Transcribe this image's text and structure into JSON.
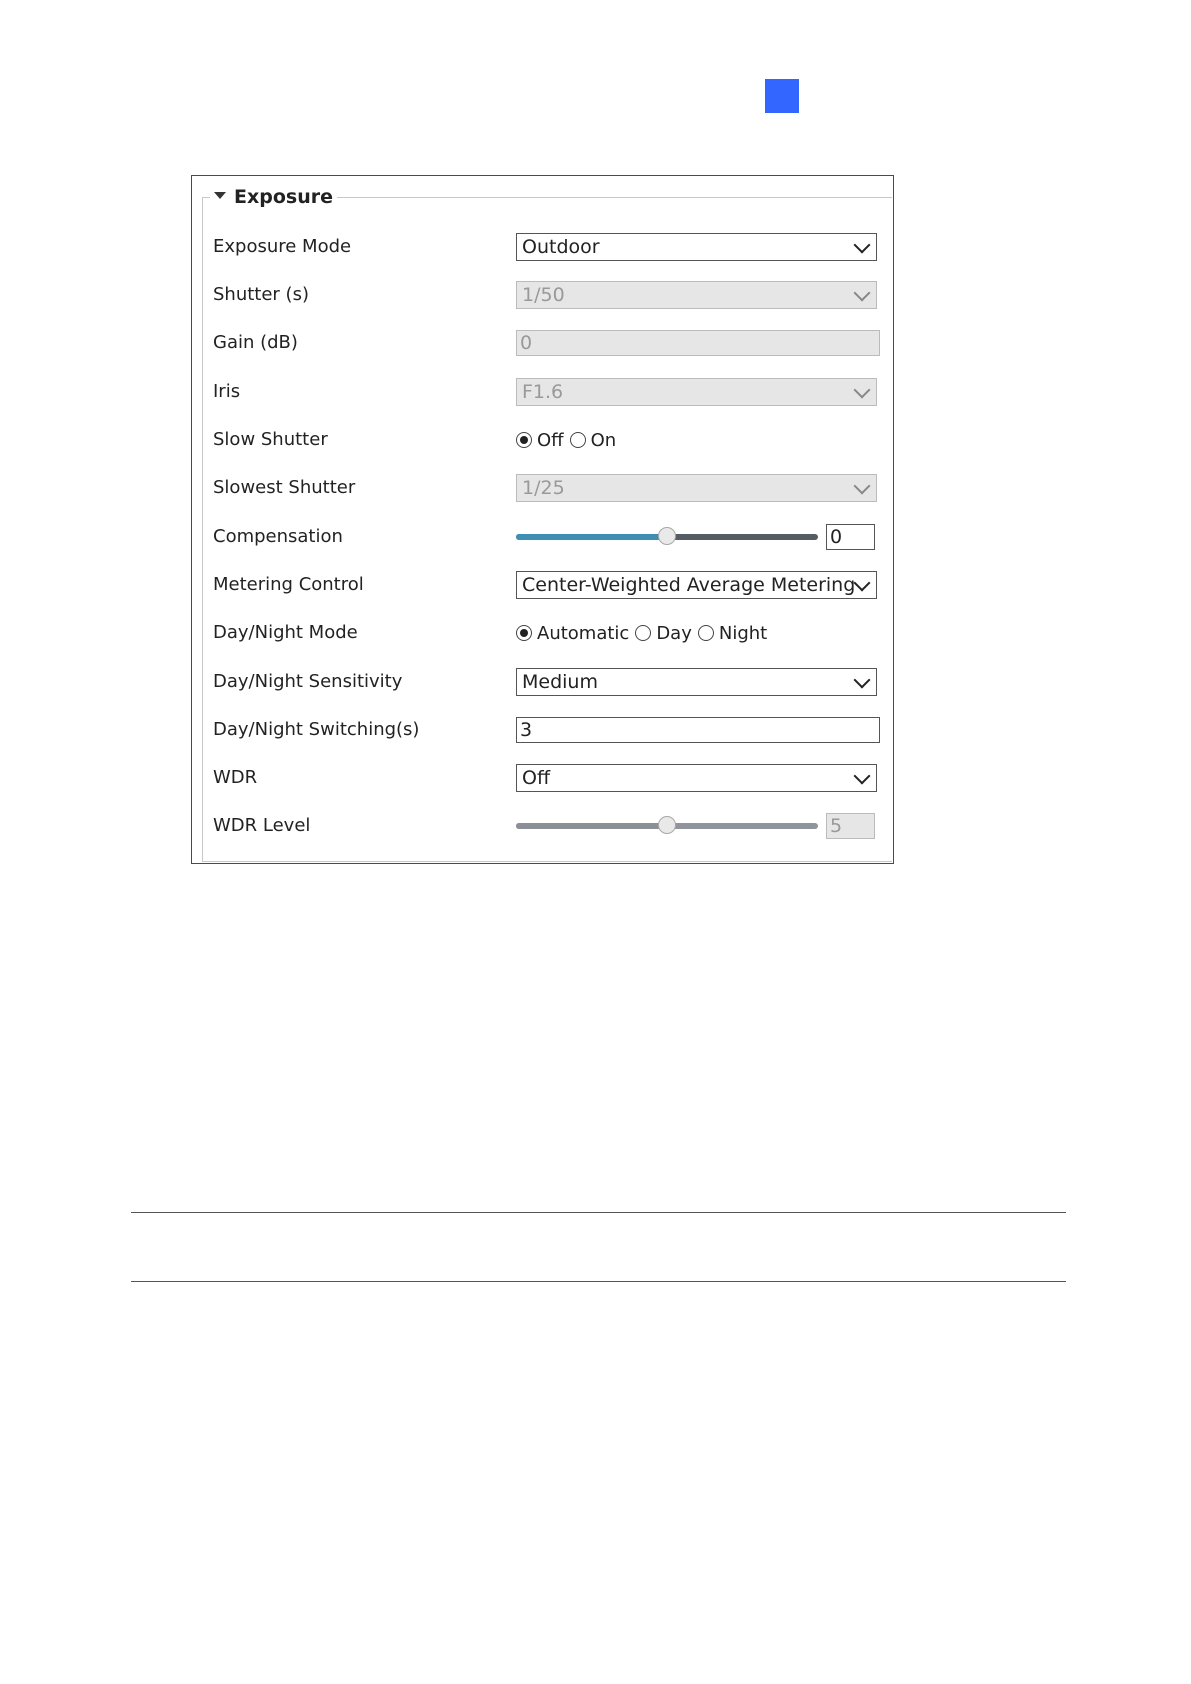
{
  "panel": {
    "legend": "Exposure",
    "fields": {
      "exposure_mode": {
        "label": "Exposure Mode",
        "value": "Outdoor"
      },
      "shutter": {
        "label": "Shutter (s)",
        "value": "1/50"
      },
      "gain": {
        "label": "Gain (dB)",
        "value": "0"
      },
      "iris": {
        "label": "Iris",
        "value": "F1.6"
      },
      "slow_shutter": {
        "label": "Slow Shutter",
        "options": [
          "Off",
          "On"
        ],
        "selected": "Off"
      },
      "slowest_shutter": {
        "label": "Slowest Shutter",
        "value": "1/25"
      },
      "compensation": {
        "label": "Compensation",
        "value": "0",
        "slider_fraction": 0.5
      },
      "metering_control": {
        "label": "Metering Control",
        "value": "Center-Weighted Average Metering"
      },
      "day_night_mode": {
        "label": "Day/Night Mode",
        "options": [
          "Automatic",
          "Day",
          "Night"
        ],
        "selected": "Automatic"
      },
      "day_night_sensitivity": {
        "label": "Day/Night Sensitivity",
        "value": "Medium"
      },
      "day_night_switching": {
        "label": "Day/Night Switching(s)",
        "value": "3"
      },
      "wdr": {
        "label": "WDR",
        "value": "Off"
      },
      "wdr_level": {
        "label": "WDR Level",
        "value": "5",
        "slider_fraction": 0.5
      }
    }
  },
  "colors": {
    "accent_square": "#3366ff",
    "slider_fill": "#3f8fb3"
  }
}
